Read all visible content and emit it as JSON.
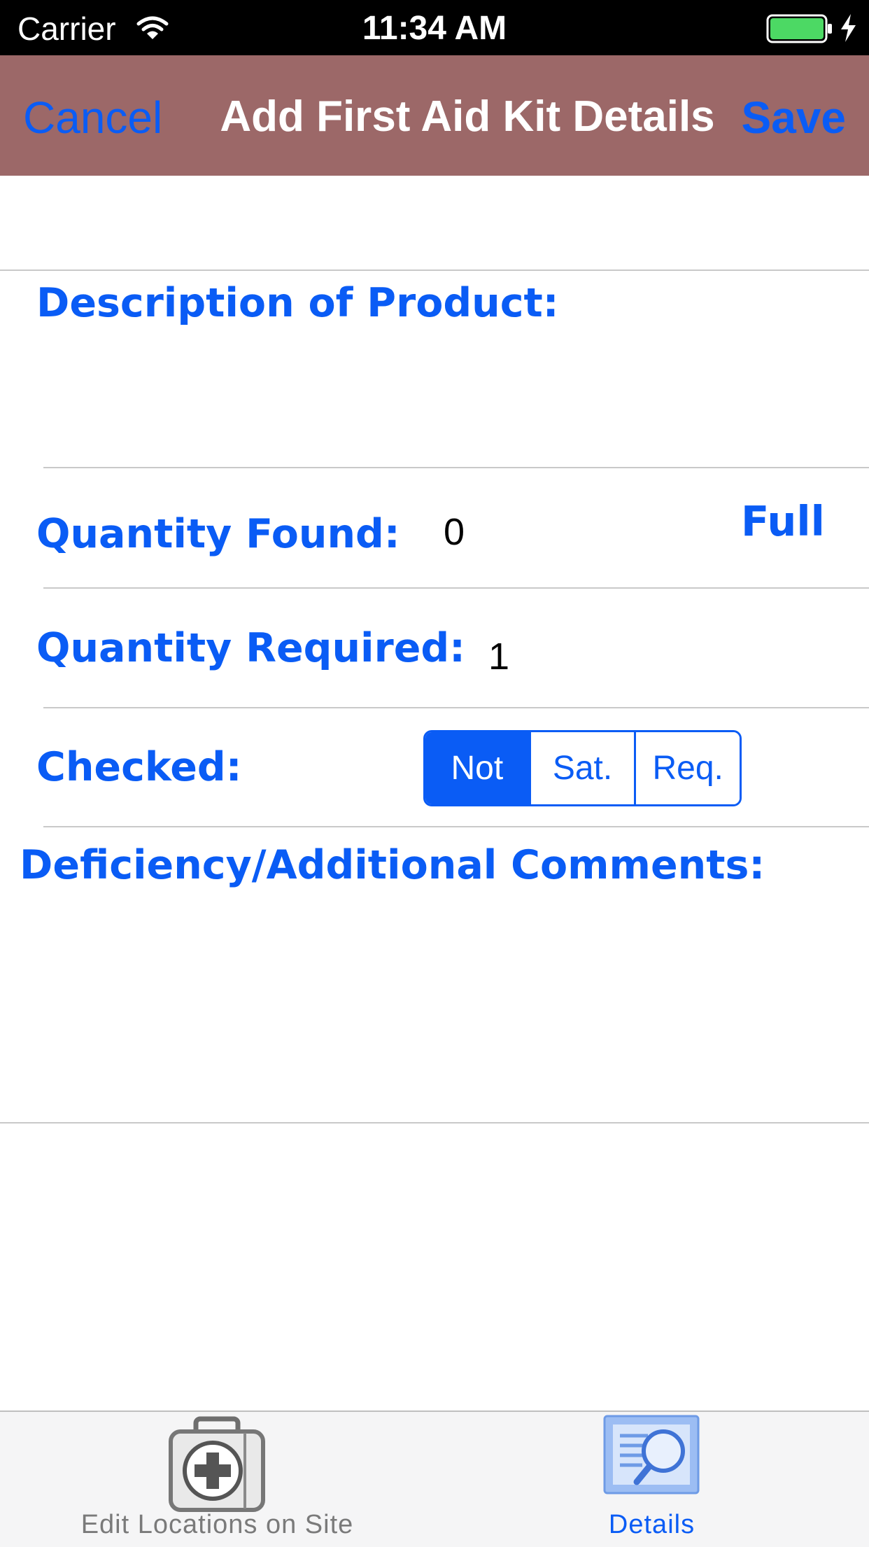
{
  "status_bar": {
    "carrier": "Carrier",
    "time": "11:34 AM"
  },
  "nav": {
    "cancel_label": "Cancel",
    "title": "Add First Aid Kit Details",
    "save_label": "Save"
  },
  "form": {
    "description_label": "Description of Product:",
    "quantity_found_label": "Quantity Found:",
    "quantity_found_value": "0",
    "full_label": "Full",
    "quantity_required_label": "Quantity Required:",
    "quantity_required_value": "1",
    "checked_label": "Checked:",
    "checked_options": [
      "Not",
      "Sat.",
      "Req."
    ],
    "checked_selected": "Not",
    "comments_label": "Deficiency/Additional Comments:"
  },
  "tab_bar": {
    "tabs": [
      {
        "label": "Edit Locations on Site",
        "icon": "first-aid-kit-icon",
        "selected": false
      },
      {
        "label": "Details",
        "icon": "magnifier-document-icon",
        "selected": true
      }
    ]
  },
  "colors": {
    "accent": "#0a5cf5",
    "nav_background": "#9c6868",
    "battery_fill": "#4cd964"
  }
}
